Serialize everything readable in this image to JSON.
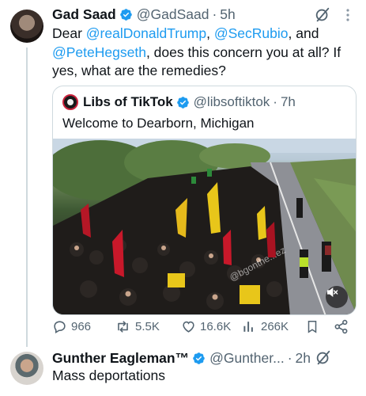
{
  "tweet": {
    "author_name": "Gad Saad",
    "handle": "@GadSaad",
    "time": "5h",
    "text": {
      "part1": "Dear ",
      "mention1": "@realDonaldTrump",
      "part2": ", ",
      "mention2": "@SecRubio",
      "part3": ", and ",
      "mention3": "@PeteHegseth",
      "part4": ", does this concern you at all?  If yes, what are the remedies?"
    },
    "quoted": {
      "author_name": "Libs of TikTok",
      "handle": "@libsoftiktok",
      "time": "7h",
      "text": "Welcome to Dearborn, Michigan",
      "watermark": "@bgonthe...ez"
    },
    "stats": {
      "replies": "966",
      "reposts": "5.5K",
      "likes": "16.6K",
      "views": "266K"
    }
  },
  "reply": {
    "author_name": "Gunther Eagleman™",
    "handle": "@Gunther...",
    "time": "2h",
    "text": "Mass deportations"
  },
  "separator": "·",
  "colors": {
    "link": "#1d9bf0",
    "secondary_text": "#536471",
    "border": "#cfd9de",
    "verified": "#1d9bf0"
  }
}
